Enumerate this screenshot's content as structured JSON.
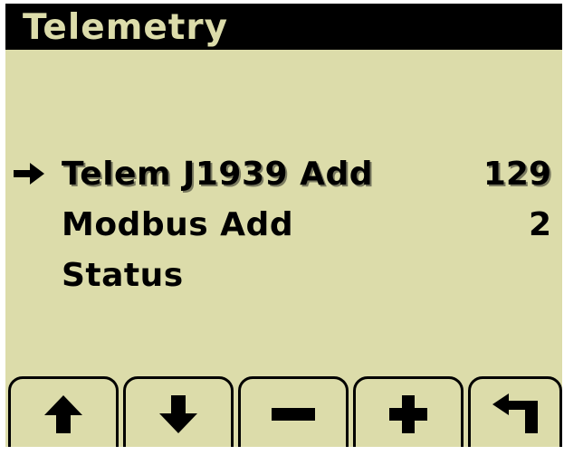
{
  "screen": {
    "title": "Telemetry",
    "colors": {
      "background": "#dcdcaa",
      "foreground": "#000000",
      "title_bar": "#000000"
    }
  },
  "menu": {
    "items": [
      {
        "label": "Telem J1939 Add",
        "value": "129",
        "selected": true
      },
      {
        "label": "Modbus Add",
        "value": "2",
        "selected": false
      },
      {
        "label": "Status",
        "value": "",
        "selected": false
      }
    ],
    "cursor_icon": "right-arrow-icon"
  },
  "softkeys": [
    {
      "name": "up",
      "icon": "up-arrow-icon"
    },
    {
      "name": "down",
      "icon": "down-arrow-icon"
    },
    {
      "name": "minus",
      "icon": "minus-icon"
    },
    {
      "name": "plus",
      "icon": "plus-icon"
    },
    {
      "name": "back",
      "icon": "return-arrow-icon"
    }
  ]
}
